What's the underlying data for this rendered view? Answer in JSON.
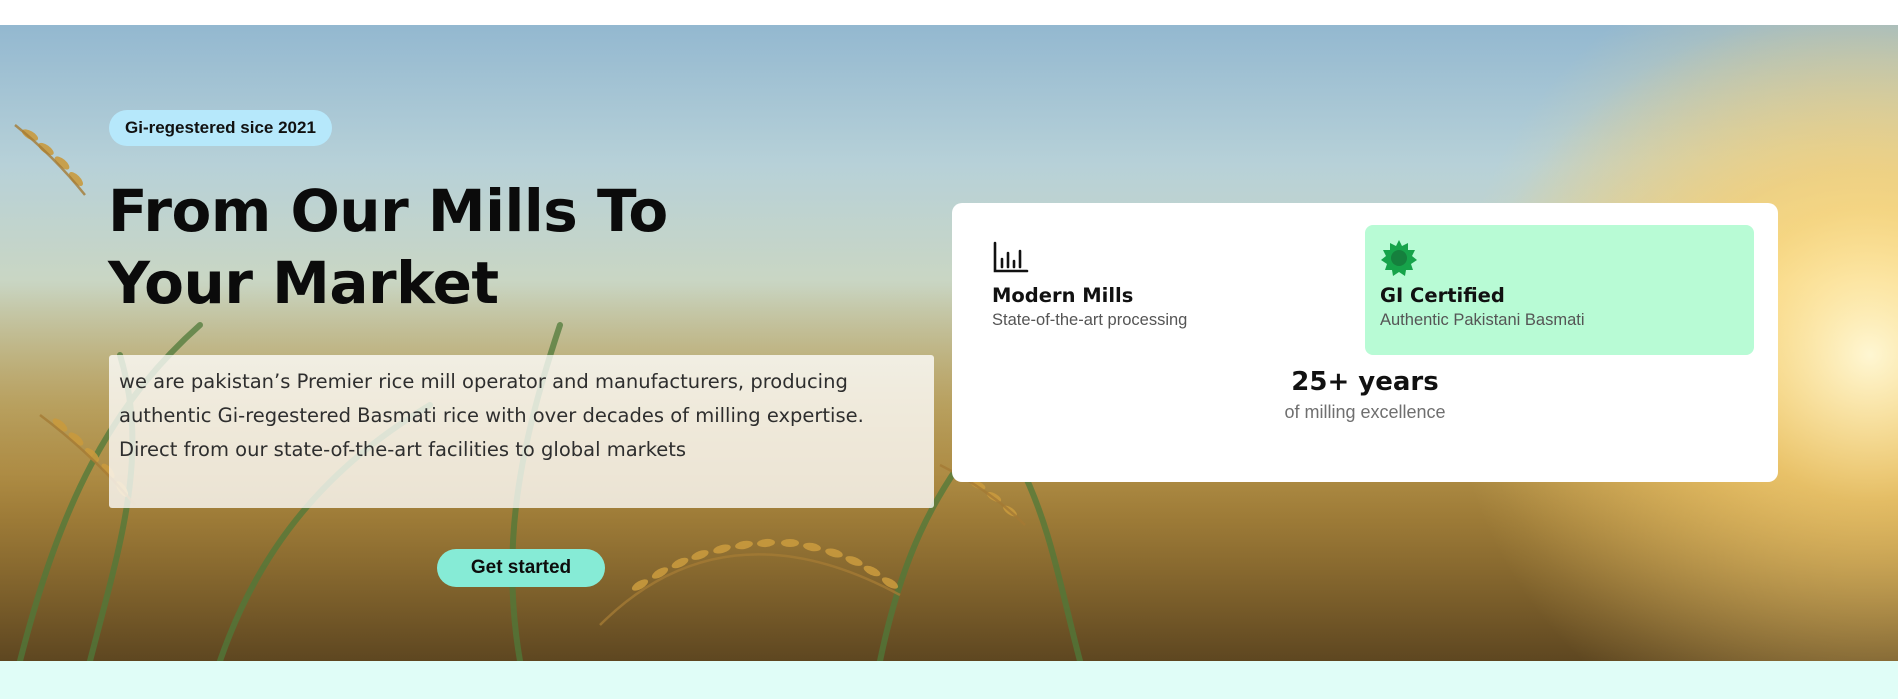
{
  "hero": {
    "badge": "Gi-regestered sice 2021",
    "title": "From Our Mills To Your Market",
    "description": "we are pakistan’s Premier rice mill operator and manufacturers, producing authentic Gi-regestered Basmati rice with over decades of milling expertise. Direct from our state-of-the-art facilities to global markets",
    "cta_label": "Get started"
  },
  "stats": {
    "features": [
      {
        "icon": "bar-chart-icon",
        "title": "Modern Mills",
        "subtitle": "State-of-the-art processing"
      },
      {
        "icon": "certificate-seal-icon",
        "title": "GI Certified",
        "subtitle": "Authentic Pakistani Basmati"
      }
    ],
    "years_value": "25+ years",
    "years_label": "of milling excellence"
  },
  "colors": {
    "badge_bg": "#b6e8fb",
    "cta_bg": "#86ebd6",
    "gi_card_bg": "#b8fbd5",
    "seal_green": "#16a34a",
    "bottom_band": "#e0fdf7"
  }
}
